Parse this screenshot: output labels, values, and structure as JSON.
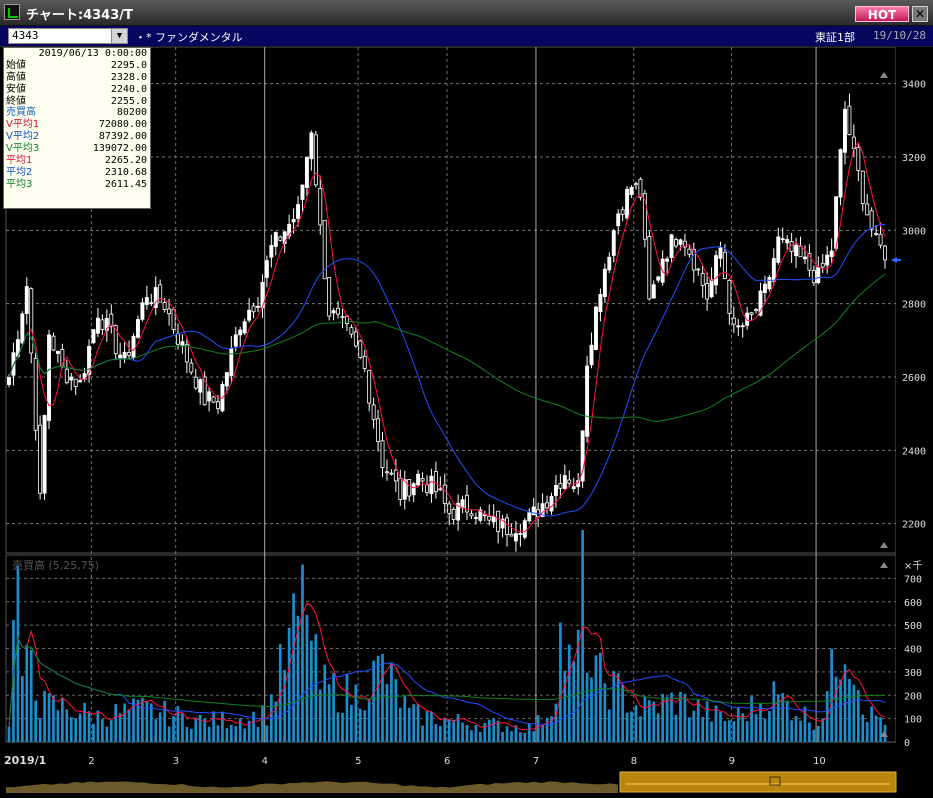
{
  "window": {
    "title": "チャート:4343/T",
    "hot_label": "HOT",
    "close_label": "✕"
  },
  "toolbar": {
    "symbol": "4343",
    "fundamental": "・* ファンダメンタル",
    "market": "東証1部",
    "date": "19/10/28"
  },
  "info": {
    "datetime": "2019/06/13  0:00:00",
    "rows": [
      {
        "label": "始値",
        "value": "2295.0",
        "color": "#000000"
      },
      {
        "label": "高値",
        "value": "2328.0",
        "color": "#000000"
      },
      {
        "label": "安値",
        "value": "2240.0",
        "color": "#000000"
      },
      {
        "label": "終値",
        "value": "2255.0",
        "color": "#000000"
      },
      {
        "label": "売買高",
        "value": "80200",
        "color": "#1060c0"
      },
      {
        "label": "V平均1",
        "value": "72080.00",
        "color": "#d01030"
      },
      {
        "label": "V平均2",
        "value": "87392.00",
        "color": "#1050c0"
      },
      {
        "label": "V平均3",
        "value": "139072.00",
        "color": "#108030"
      },
      {
        "label": "平均1",
        "value": "2265.20",
        "color": "#d01030"
      },
      {
        "label": "平均2",
        "value": "2310.68",
        "color": "#1050c0"
      },
      {
        "label": "平均3",
        "value": "2611.45",
        "color": "#108030"
      }
    ]
  },
  "volume_label": "売買高 (5,25,75)",
  "volume_unit": "×千",
  "chart_data": {
    "type": "candlestick",
    "price_ticks": [
      2200,
      2400,
      2600,
      2800,
      3000,
      3200,
      3400
    ],
    "price_ylim": [
      2120,
      3500
    ],
    "volume_ticks": [
      0,
      100,
      200,
      300,
      400,
      500,
      600,
      700
    ],
    "volume_ylim": [
      0,
      800
    ],
    "month_labels": [
      "2019/1",
      "2",
      "3",
      "4",
      "5",
      "6",
      "7",
      "8",
      "9",
      "10"
    ],
    "month_start_index": [
      0,
      19,
      38,
      58,
      79,
      99,
      119,
      141,
      163,
      182
    ],
    "close_anchors": [
      [
        0,
        2600
      ],
      [
        4,
        2850
      ],
      [
        6,
        2480
      ],
      [
        7,
        2260
      ],
      [
        9,
        2720
      ],
      [
        12,
        2620
      ],
      [
        16,
        2580
      ],
      [
        20,
        2780
      ],
      [
        26,
        2640
      ],
      [
        31,
        2830
      ],
      [
        35,
        2800
      ],
      [
        40,
        2650
      ],
      [
        44,
        2540
      ],
      [
        47,
        2530
      ],
      [
        52,
        2750
      ],
      [
        56,
        2820
      ],
      [
        59,
        2950
      ],
      [
        65,
        3050
      ],
      [
        68,
        3280
      ],
      [
        70,
        3000
      ],
      [
        72,
        2780
      ],
      [
        76,
        2720
      ],
      [
        80,
        2620
      ],
      [
        84,
        2370
      ],
      [
        88,
        2280
      ],
      [
        92,
        2330
      ],
      [
        96,
        2290
      ],
      [
        99,
        2230
      ],
      [
        104,
        2250
      ],
      [
        108,
        2200
      ],
      [
        112,
        2190
      ],
      [
        117,
        2210
      ],
      [
        121,
        2270
      ],
      [
        125,
        2340
      ],
      [
        128,
        2300
      ],
      [
        130,
        2650
      ],
      [
        133,
        2850
      ],
      [
        137,
        3050
      ],
      [
        140,
        3120
      ],
      [
        142,
        3100
      ],
      [
        144,
        2800
      ],
      [
        147,
        2930
      ],
      [
        151,
        3000
      ],
      [
        154,
        2920
      ],
      [
        157,
        2820
      ],
      [
        160,
        2950
      ],
      [
        163,
        2720
      ],
      [
        167,
        2760
      ],
      [
        170,
        2830
      ],
      [
        173,
        2970
      ],
      [
        178,
        2920
      ],
      [
        182,
        2870
      ],
      [
        185,
        2950
      ],
      [
        188,
        3330
      ],
      [
        190,
        3200
      ],
      [
        193,
        3050
      ],
      [
        195,
        2960
      ],
      [
        197,
        2940
      ]
    ],
    "volume_anchors": [
      [
        0,
        100
      ],
      [
        2,
        760
      ],
      [
        3,
        200
      ],
      [
        5,
        420
      ],
      [
        7,
        160
      ],
      [
        12,
        150
      ],
      [
        20,
        110
      ],
      [
        30,
        140
      ],
      [
        44,
        90
      ],
      [
        52,
        100
      ],
      [
        58,
        120
      ],
      [
        66,
        580
      ],
      [
        67,
        700
      ],
      [
        68,
        400
      ],
      [
        70,
        240
      ],
      [
        78,
        200
      ],
      [
        84,
        320
      ],
      [
        90,
        120
      ],
      [
        104,
        80
      ],
      [
        118,
        60
      ],
      [
        122,
        150
      ],
      [
        124,
        440
      ],
      [
        127,
        270
      ],
      [
        129,
        640
      ],
      [
        131,
        280
      ],
      [
        134,
        260
      ],
      [
        138,
        200
      ],
      [
        142,
        140
      ],
      [
        150,
        180
      ],
      [
        162,
        90
      ],
      [
        172,
        200
      ],
      [
        182,
        80
      ],
      [
        188,
        480
      ],
      [
        190,
        340
      ],
      [
        193,
        120
      ],
      [
        197,
        100
      ]
    ],
    "series": [
      {
        "name": "平均1",
        "period": 5,
        "color": "#ff1040"
      },
      {
        "name": "平均2",
        "period": 25,
        "color": "#2050ff"
      },
      {
        "name": "平均3",
        "period": 75,
        "color": "#108020"
      }
    ]
  },
  "icons": {
    "up_arrow": "triangle-up-icon",
    "down_arrow": "triangle-down-icon",
    "marker": "last-price-arrow-icon"
  }
}
